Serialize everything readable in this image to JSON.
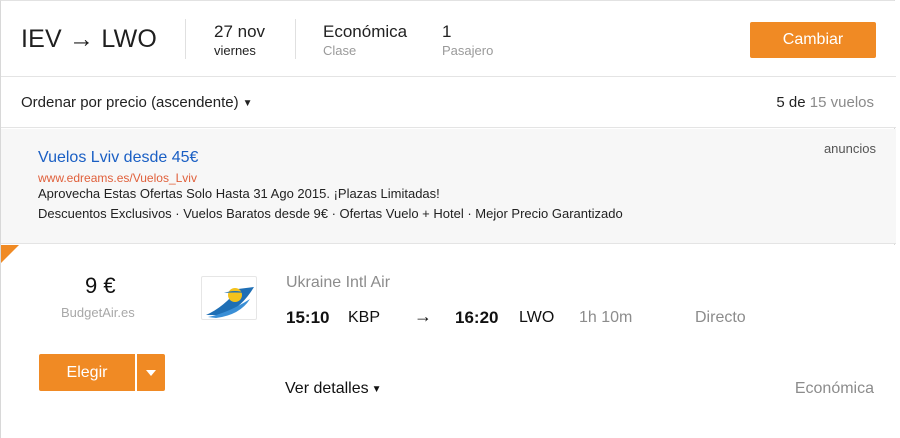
{
  "header": {
    "route": "IEV → LWO",
    "date_main": "27 nov",
    "date_sub": "viernes",
    "class_main": "Económica",
    "class_sub": "Clase",
    "pax_main": "1",
    "pax_sub": "Pasajero",
    "change_label": "Cambiar"
  },
  "sortbar": {
    "sort_label": "Ordenar por precio (ascendente)",
    "shown": "5",
    "of_label": "de",
    "total": "15 vuelos"
  },
  "ad": {
    "label": "anuncios",
    "title": "Vuelos Lviv desde 45€",
    "url": "www.edreams.es/Vuelos_Lviv",
    "line1": "Aprovecha Estas Ofertas Solo Hasta 31 Ago 2015. ¡Plazas Limitadas!",
    "line2": "Descuentos Exclusivos · Vuelos Baratos desde 9€ · Ofertas Vuelo + Hotel · Mejor Precio Garantizado"
  },
  "flight": {
    "price": "9 €",
    "provider": "BudgetAir.es",
    "airline": "Ukraine Intl Air",
    "dep_time": "15:10",
    "dep_airport": "KBP",
    "arr_time": "16:20",
    "arr_airport": "LWO",
    "duration": "1h 10m",
    "stops": "Directo",
    "choose_label": "Elegir",
    "details_label": "Ver detalles",
    "cabin": "Económica"
  },
  "colors": {
    "accent": "#f08a24",
    "link": "#1a5fc4",
    "ad_url": "#e0603b"
  }
}
